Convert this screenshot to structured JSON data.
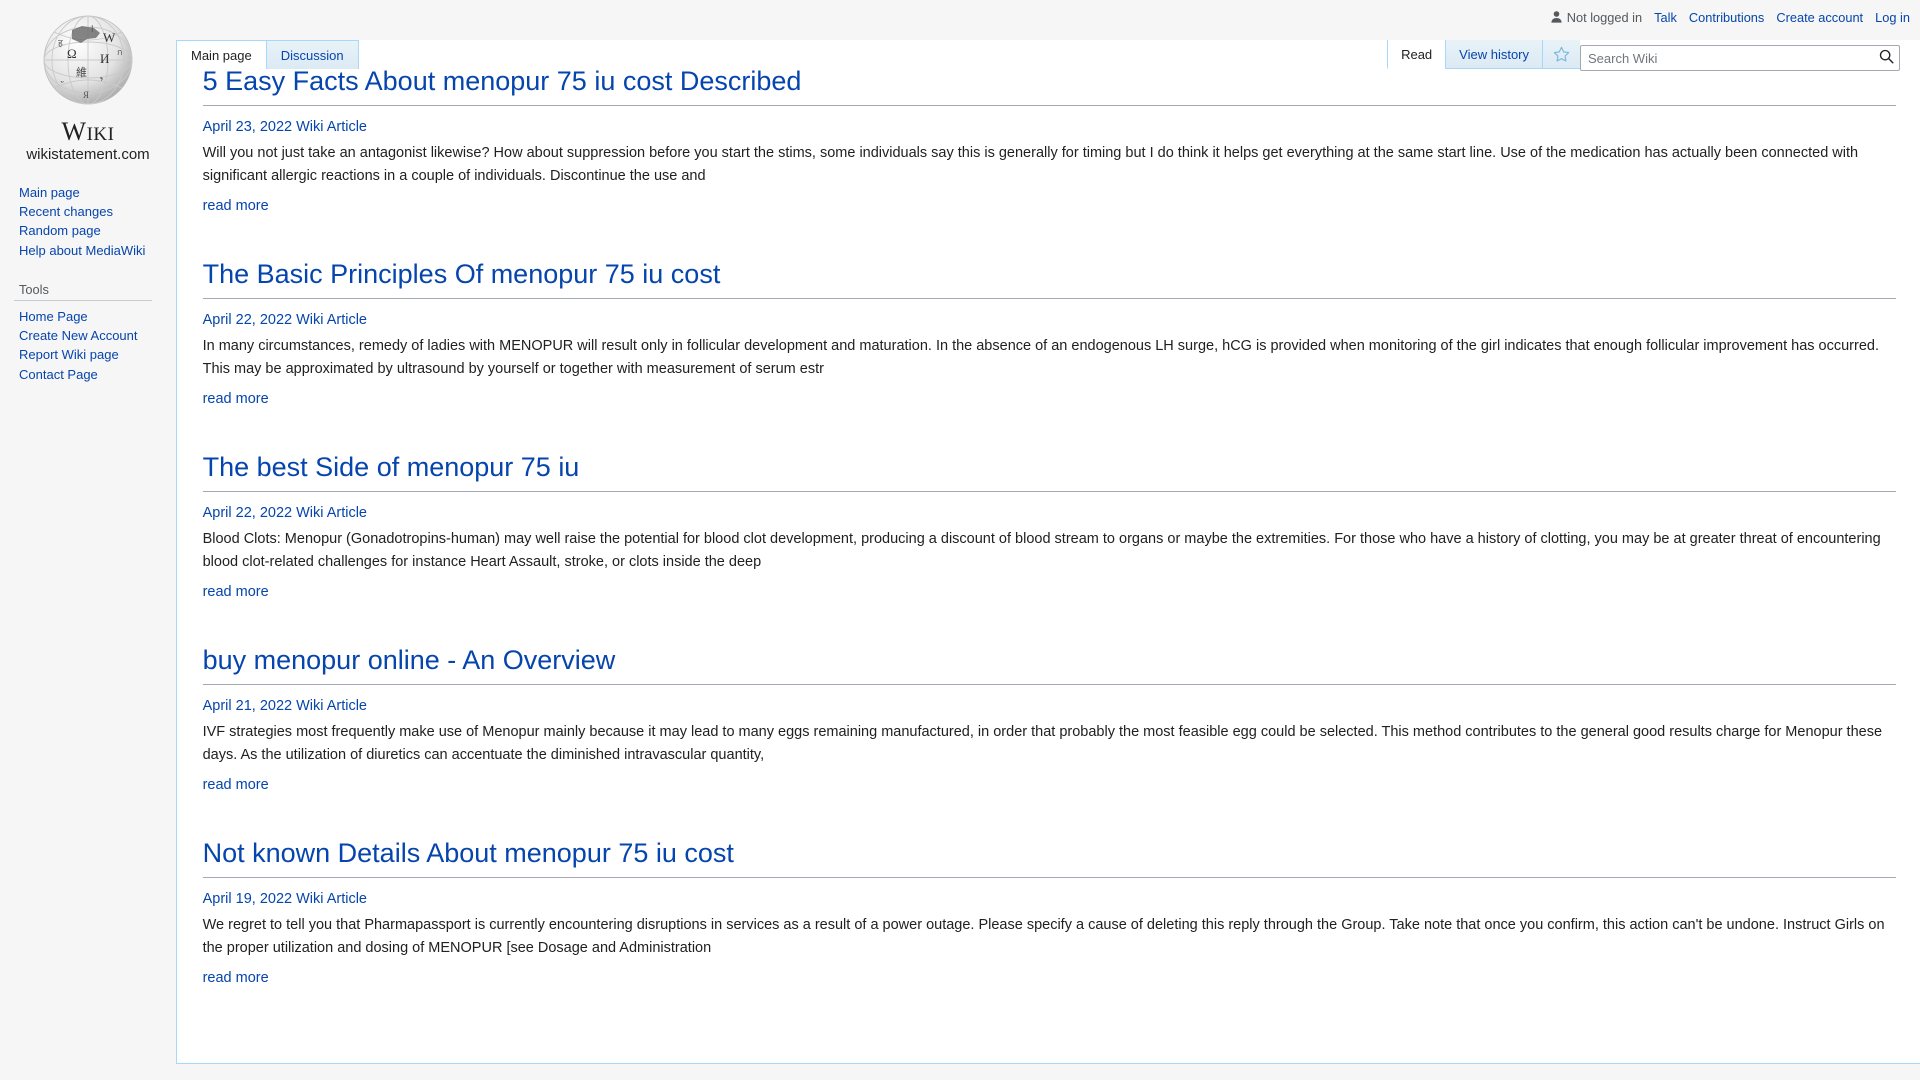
{
  "user_nav": {
    "status": "Not logged in",
    "links": [
      {
        "label": "Talk"
      },
      {
        "label": "Contributions"
      },
      {
        "label": "Create account"
      },
      {
        "label": "Log in"
      }
    ]
  },
  "branding": {
    "wordmark_first": "W",
    "wordmark_rest": "IKI",
    "tagline": "wikistatement.com"
  },
  "sidebar": {
    "navigation": [
      {
        "label": "Main page"
      },
      {
        "label": "Recent changes"
      },
      {
        "label": "Random page"
      },
      {
        "label": "Help about MediaWiki"
      }
    ],
    "tools_heading": "Tools",
    "tools": [
      {
        "label": "Home Page"
      },
      {
        "label": "Create New Account"
      },
      {
        "label": "Report Wiki page"
      },
      {
        "label": "Contact Page"
      }
    ]
  },
  "namespace_tabs": [
    {
      "label": "Main page",
      "selected": true
    },
    {
      "label": "Discussion",
      "selected": false
    }
  ],
  "view_tabs": [
    {
      "label": "Read",
      "selected": true
    },
    {
      "label": "View history",
      "selected": false
    }
  ],
  "watch_star": {
    "name": "star-icon"
  },
  "search": {
    "placeholder": "Search Wiki",
    "value": "",
    "button_icon": "search-icon"
  },
  "articles": [
    {
      "title": "5 Easy Facts About menopur 75 iu cost Described",
      "meta": "April 23, 2022 Wiki Article",
      "body": "Will you not just take an antagonist likewise? How about suppression before you start the stims, some individuals say this is generally for timing but I do think it helps get everything at the same start line. Use of the medication has actually been connected with significant allergic reactions in a couple of individuals. Discontinue the use and",
      "read_more": "read more"
    },
    {
      "title": "The Basic Principles Of menopur 75 iu cost",
      "meta": "April 22, 2022 Wiki Article",
      "body": "In many circumstances, remedy of ladies with MENOPUR will result only in follicular development and maturation. In the absence of an endogenous LH surge, hCG is provided when monitoring of the girl indicates that enough follicular improvement has occurred. This may be approximated by ultrasound by yourself or together with measurement of serum estr",
      "read_more": "read more"
    },
    {
      "title": "The best Side of menopur 75 iu",
      "meta": "April 22, 2022 Wiki Article",
      "body": "Blood Clots: Menopur (Gonadotropins-human) may well raise the potential for blood clot development, producing a discount of blood stream to organs or maybe the extremities. For those who have a history of clotting, you may be at greater threat of encountering blood clot-related challenges for instance Heart Assault, stroke, or clots inside the deep",
      "read_more": "read more"
    },
    {
      "title": "buy menopur online - An Overview",
      "meta": "April 21, 2022 Wiki Article",
      "body": "IVF strategies most frequently make use of Menopur mainly because it may lead to many eggs remaining manufactured, in order that probably the most feasible egg could be selected. This method contributes to the general good results charge for Menopur these days. As the utilization of diuretics can accentuate the diminished intravascular quantity,",
      "read_more": "read more"
    },
    {
      "title": "Not known Details About menopur 75 iu cost",
      "meta": "April 19, 2022 Wiki Article",
      "body": "We regret to tell you that Pharmapassport is currently encountering disruptions in services as a result of a power outage. Please specify a cause of deleting this reply through the Group. Take note that once you confirm, this action can't be undone. Instruct Girls on the proper utilization and dosing of MENOPUR [see Dosage and Administration",
      "read_more": "read more"
    }
  ],
  "colors": {
    "link": "#0645ad",
    "tab_border": "#a7d7f9",
    "panel_bg": "#f6f6f6"
  }
}
